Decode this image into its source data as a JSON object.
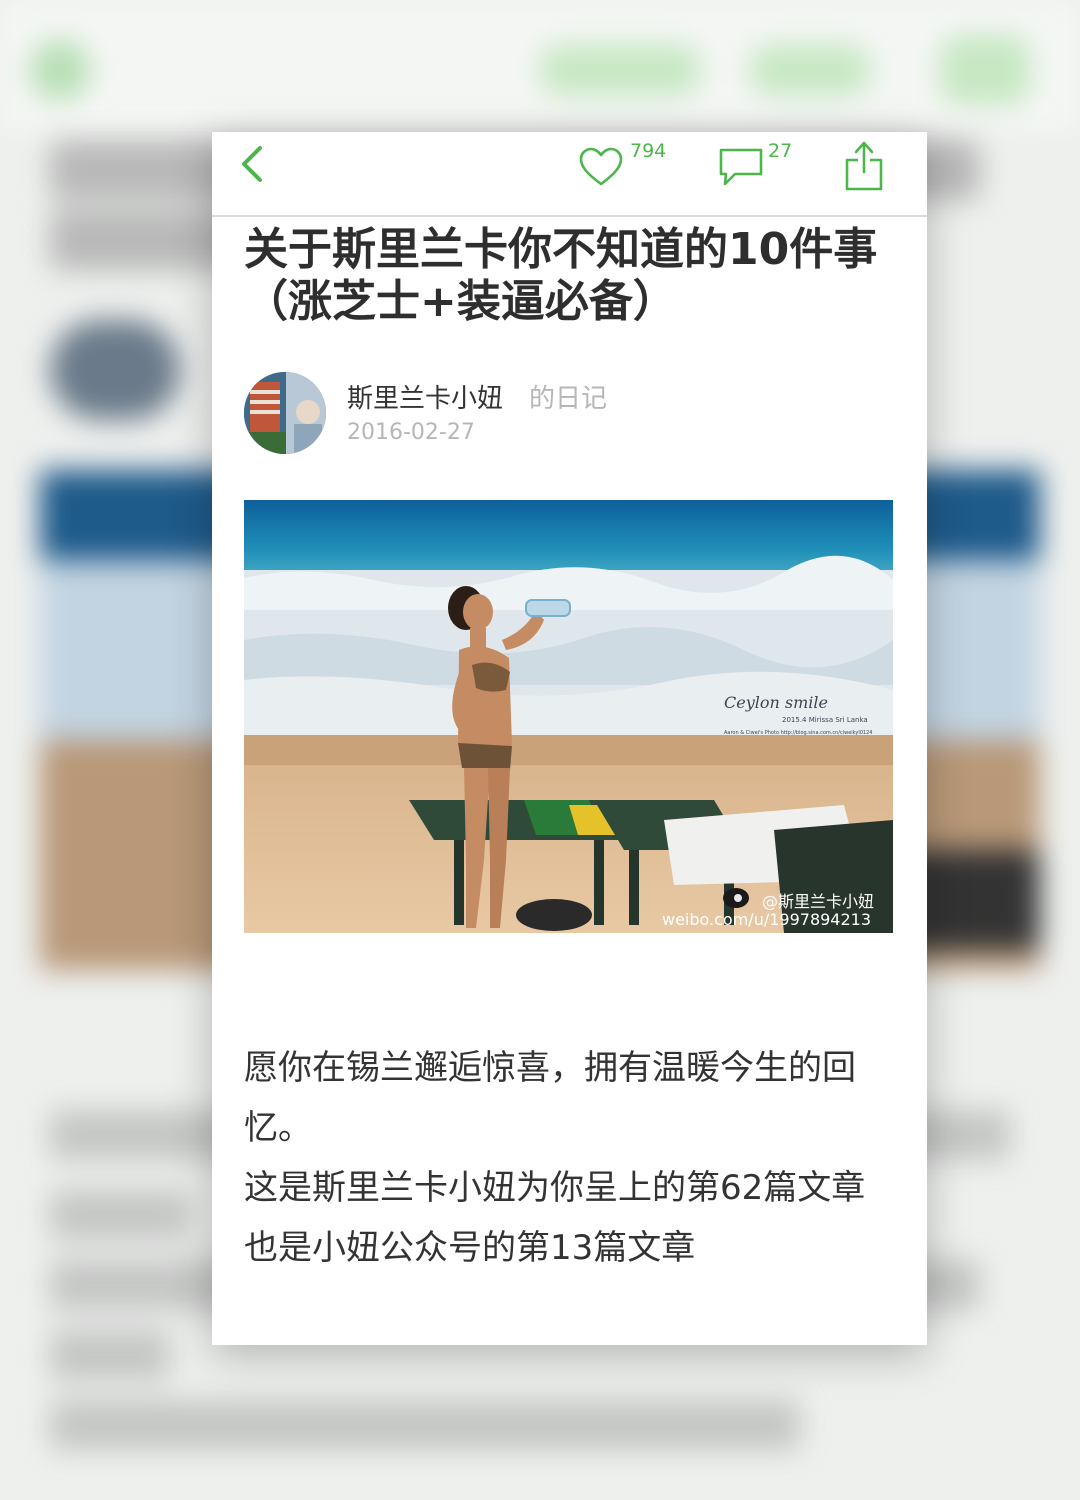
{
  "article": {
    "title": "关于斯里兰卡你不知道的10件事（涨芝士+装逼必备）",
    "author": "斯里兰卡小妞",
    "author_suffix": "的日记",
    "date": "2016-02-27",
    "likes": "794",
    "comments": "27",
    "photo": {
      "watermark_title": "Ceylon smile",
      "watermark_sub": "2015.4 Mirissa Sri Lanka",
      "watermark_small": "Aaron & Ciwei's Photo  http://blog.sina.com.cn/ciweikyl0124",
      "weibo_handle": "@斯里兰卡小妞",
      "weibo_url": "weibo.com/u/1997894213"
    },
    "paragraphs": [
      "愿你在锡兰邂逅惊喜，拥有温暖今生的回忆。",
      "这是斯里兰卡小妞为你呈上的第62篇文章",
      "也是小妞公众号的第13篇文章"
    ]
  },
  "colors": {
    "accent": "#4cb64a",
    "text": "#333333",
    "muted": "#b6b6b6"
  },
  "icons": [
    "back-icon",
    "heart-icon",
    "comment-icon",
    "share-icon"
  ]
}
